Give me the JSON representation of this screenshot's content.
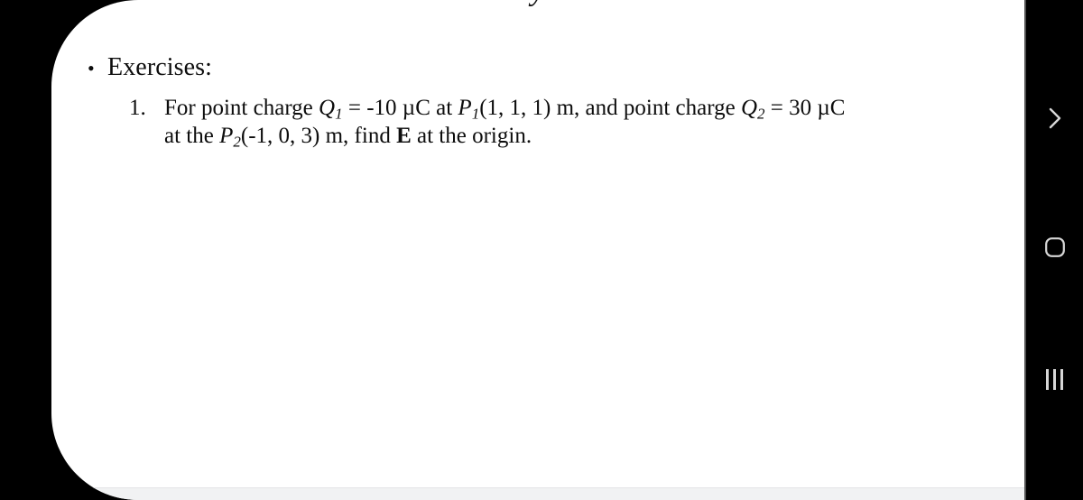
{
  "slide": {
    "cut_off_text_above": "y",
    "bullet_marker": "•",
    "bullet_label": "Exercises:",
    "item": {
      "marker": "1.",
      "line1": {
        "seg1": "For point charge ",
        "q1": "Q",
        "q1_sub": "1",
        "seg2": " = -10 µC at ",
        "p1": "P",
        "p1_sub": "1",
        "seg3": "(1, 1, 1) m, and point charge ",
        "q2": "Q",
        "q2_sub": "2",
        "seg4": " = 30 µC"
      },
      "line2": {
        "seg1": "at the ",
        "p2": "P",
        "p2_sub": "2",
        "seg2": "(-1, 0, 3) m, find ",
        "evec": "E",
        "seg3": " at the origin."
      }
    }
  },
  "navbar": {
    "back": {
      "label": "Back",
      "icon": "chevron-right-icon"
    },
    "home": {
      "label": "Home",
      "icon": "home-rounded-square-icon"
    },
    "recents": {
      "label": "Recent apps",
      "icon": "recents-bars-icon"
    }
  },
  "colors": {
    "page_background": "#000000",
    "slide_background": "#ffffff",
    "text": "#0d0d0d",
    "navbar_background": "#000000",
    "navbar_icon": "#d7d7d7",
    "bottom_strip": "#f1f2f3"
  }
}
